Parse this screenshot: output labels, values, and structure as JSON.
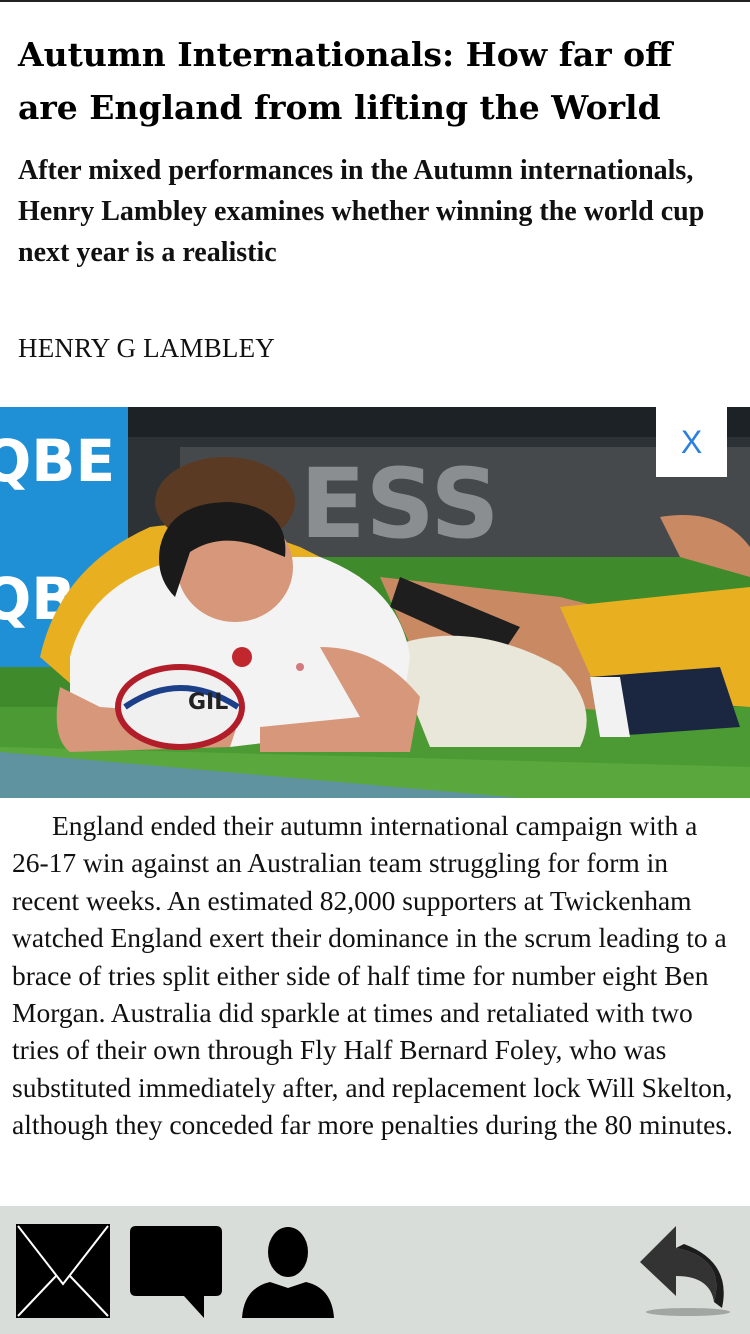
{
  "article": {
    "headline": "Autumn Internationals: How far off are England from lifting the World",
    "subheadline": "After mixed performances in the Autumn internationals, Henry Lambley examines whether winning the world cup next year is a realistic",
    "byline": "HENRY G LAMBLEY",
    "photo": {
      "sponsor_text": "QBE",
      "banner_text": "ESS",
      "ball_text": "GIL",
      "close_label": "X"
    },
    "body": "England ended their autumn international campaign with a 26-17 win against an Australian team struggling for form in recent weeks. An estimated 82,000 supporters at Twickenham watched England exert their dominance in the scrum leading to a brace of tries split either side of half time for number eight Ben Morgan. Australia did sparkle at times and retaliated with two tries of their own through Fly Half Bernard Foley, who was substituted immediately after, and replacement lock Will Skelton, although they conceded far more penalties during the 80 minutes."
  },
  "toolbar": {
    "icons": [
      "mail-icon",
      "comment-icon",
      "profile-icon",
      "back-arrow-icon"
    ]
  },
  "colors": {
    "close_text": "#2a7fe0",
    "toolbar_bg": "#d9ddd9",
    "grass": "#3f8a2a",
    "sponsor_blue": "#1f8fd6",
    "australia_gold": "#e8b020"
  }
}
